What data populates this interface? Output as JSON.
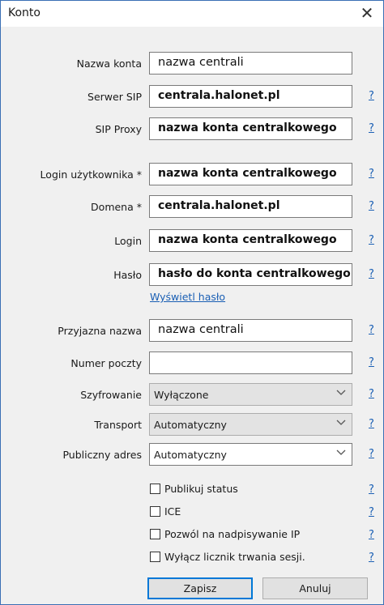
{
  "window": {
    "title": "Konto",
    "close_glyph": "✕"
  },
  "fields": [
    {
      "key": "nazwa-konta",
      "label": "Nazwa konta",
      "value": "nazwa centrali",
      "help": "?"
    },
    {
      "key": "serwer-sip",
      "label": "Serwer SIP",
      "value": "centrala.halonet.pl",
      "help": "?"
    },
    {
      "key": "sip-proxy",
      "label": "SIP Proxy",
      "value": "nazwa konta centralkowego",
      "help": "?"
    },
    {
      "key": "login-uzytkownika",
      "label": "Login użytkownika *",
      "value": "nazwa konta centralkowego",
      "help": "?"
    },
    {
      "key": "domena",
      "label": "Domena *",
      "value": "centrala.halonet.pl",
      "help": "?"
    },
    {
      "key": "login",
      "label": "Login",
      "value": "nazwa konta centralkowego",
      "help": "?"
    },
    {
      "key": "haslo",
      "label": "Hasło",
      "value": "hasło do konta centralkowego",
      "help": "?"
    },
    {
      "key": "przyjazna-nazwa",
      "label": "Przyjazna nazwa",
      "value": "nazwa centrali",
      "help": "?"
    },
    {
      "key": "numer-poczty",
      "label": "Numer poczty",
      "value": "",
      "help": "?"
    }
  ],
  "show_password_link": "Wyświetl hasło",
  "selects": [
    {
      "key": "szyfrowanie",
      "label": "Szyfrowanie",
      "value": "Wyłączone",
      "help": "?"
    },
    {
      "key": "transport",
      "label": "Transport",
      "value": "Automatyczny",
      "help": "?"
    },
    {
      "key": "publiczny-adres",
      "label": "Publiczny adres",
      "value": "Automatyczny",
      "help": "?"
    }
  ],
  "checkboxes": [
    {
      "key": "publikuj-status",
      "label": "Publikuj status",
      "checked": false,
      "help": "?"
    },
    {
      "key": "ice",
      "label": "ICE",
      "checked": false,
      "help": "?"
    },
    {
      "key": "pozwol-nadpisywanie-ip",
      "label": "Pozwól na nadpisywanie IP",
      "checked": false,
      "help": "?"
    },
    {
      "key": "wylacz-licznik",
      "label": "Wyłącz licznik trwania sesji.",
      "checked": false,
      "help": "?"
    }
  ],
  "buttons": {
    "save": "Zapisz",
    "cancel": "Anuluj"
  },
  "colors": {
    "accent": "#0078d7",
    "link": "#1a5fb4",
    "border": "#3a6fb5",
    "panel": "#f0f0f0"
  },
  "icons": {
    "close": "close-icon",
    "chevron": "chevron-down-icon"
  }
}
